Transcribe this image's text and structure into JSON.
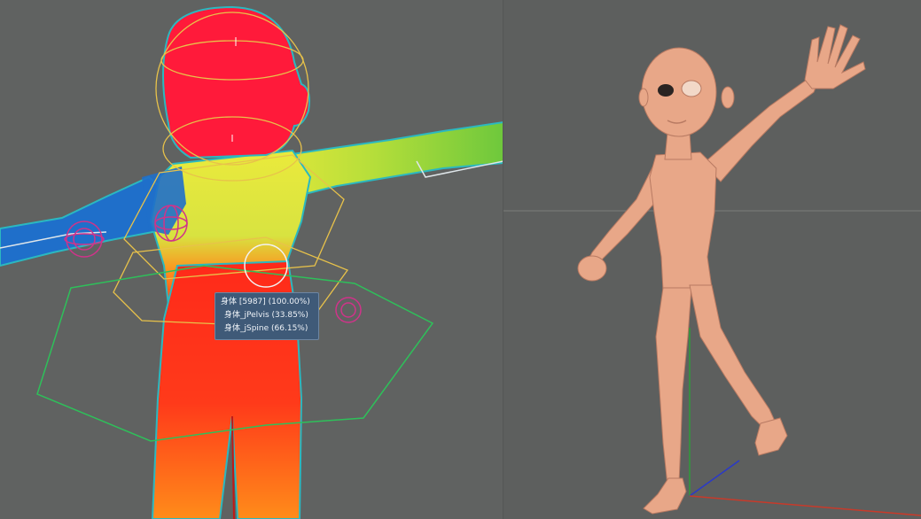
{
  "weight_tooltip": {
    "header": "身体 [5987] (100.00%)",
    "entries": [
      "身体_jPelvis (33.85%)",
      "身体_jSpine (66.15%)"
    ]
  },
  "colors": {
    "viewport_bg": "#606261",
    "weight_max": "#ff1a2e",
    "weight_high": "#ff7a1c",
    "weight_mid": "#e8e83a",
    "weight_lowmid": "#7fd23c",
    "weight_low": "#1e6fc8",
    "joint_gizmo": "#e8c24a",
    "control_ring": "#d0338a",
    "hex_controller": "#2ec05a",
    "skin": "#e8a788"
  },
  "icons": [
    "joint-icon",
    "control-ring-icon",
    "axis-gizmo-icon"
  ]
}
